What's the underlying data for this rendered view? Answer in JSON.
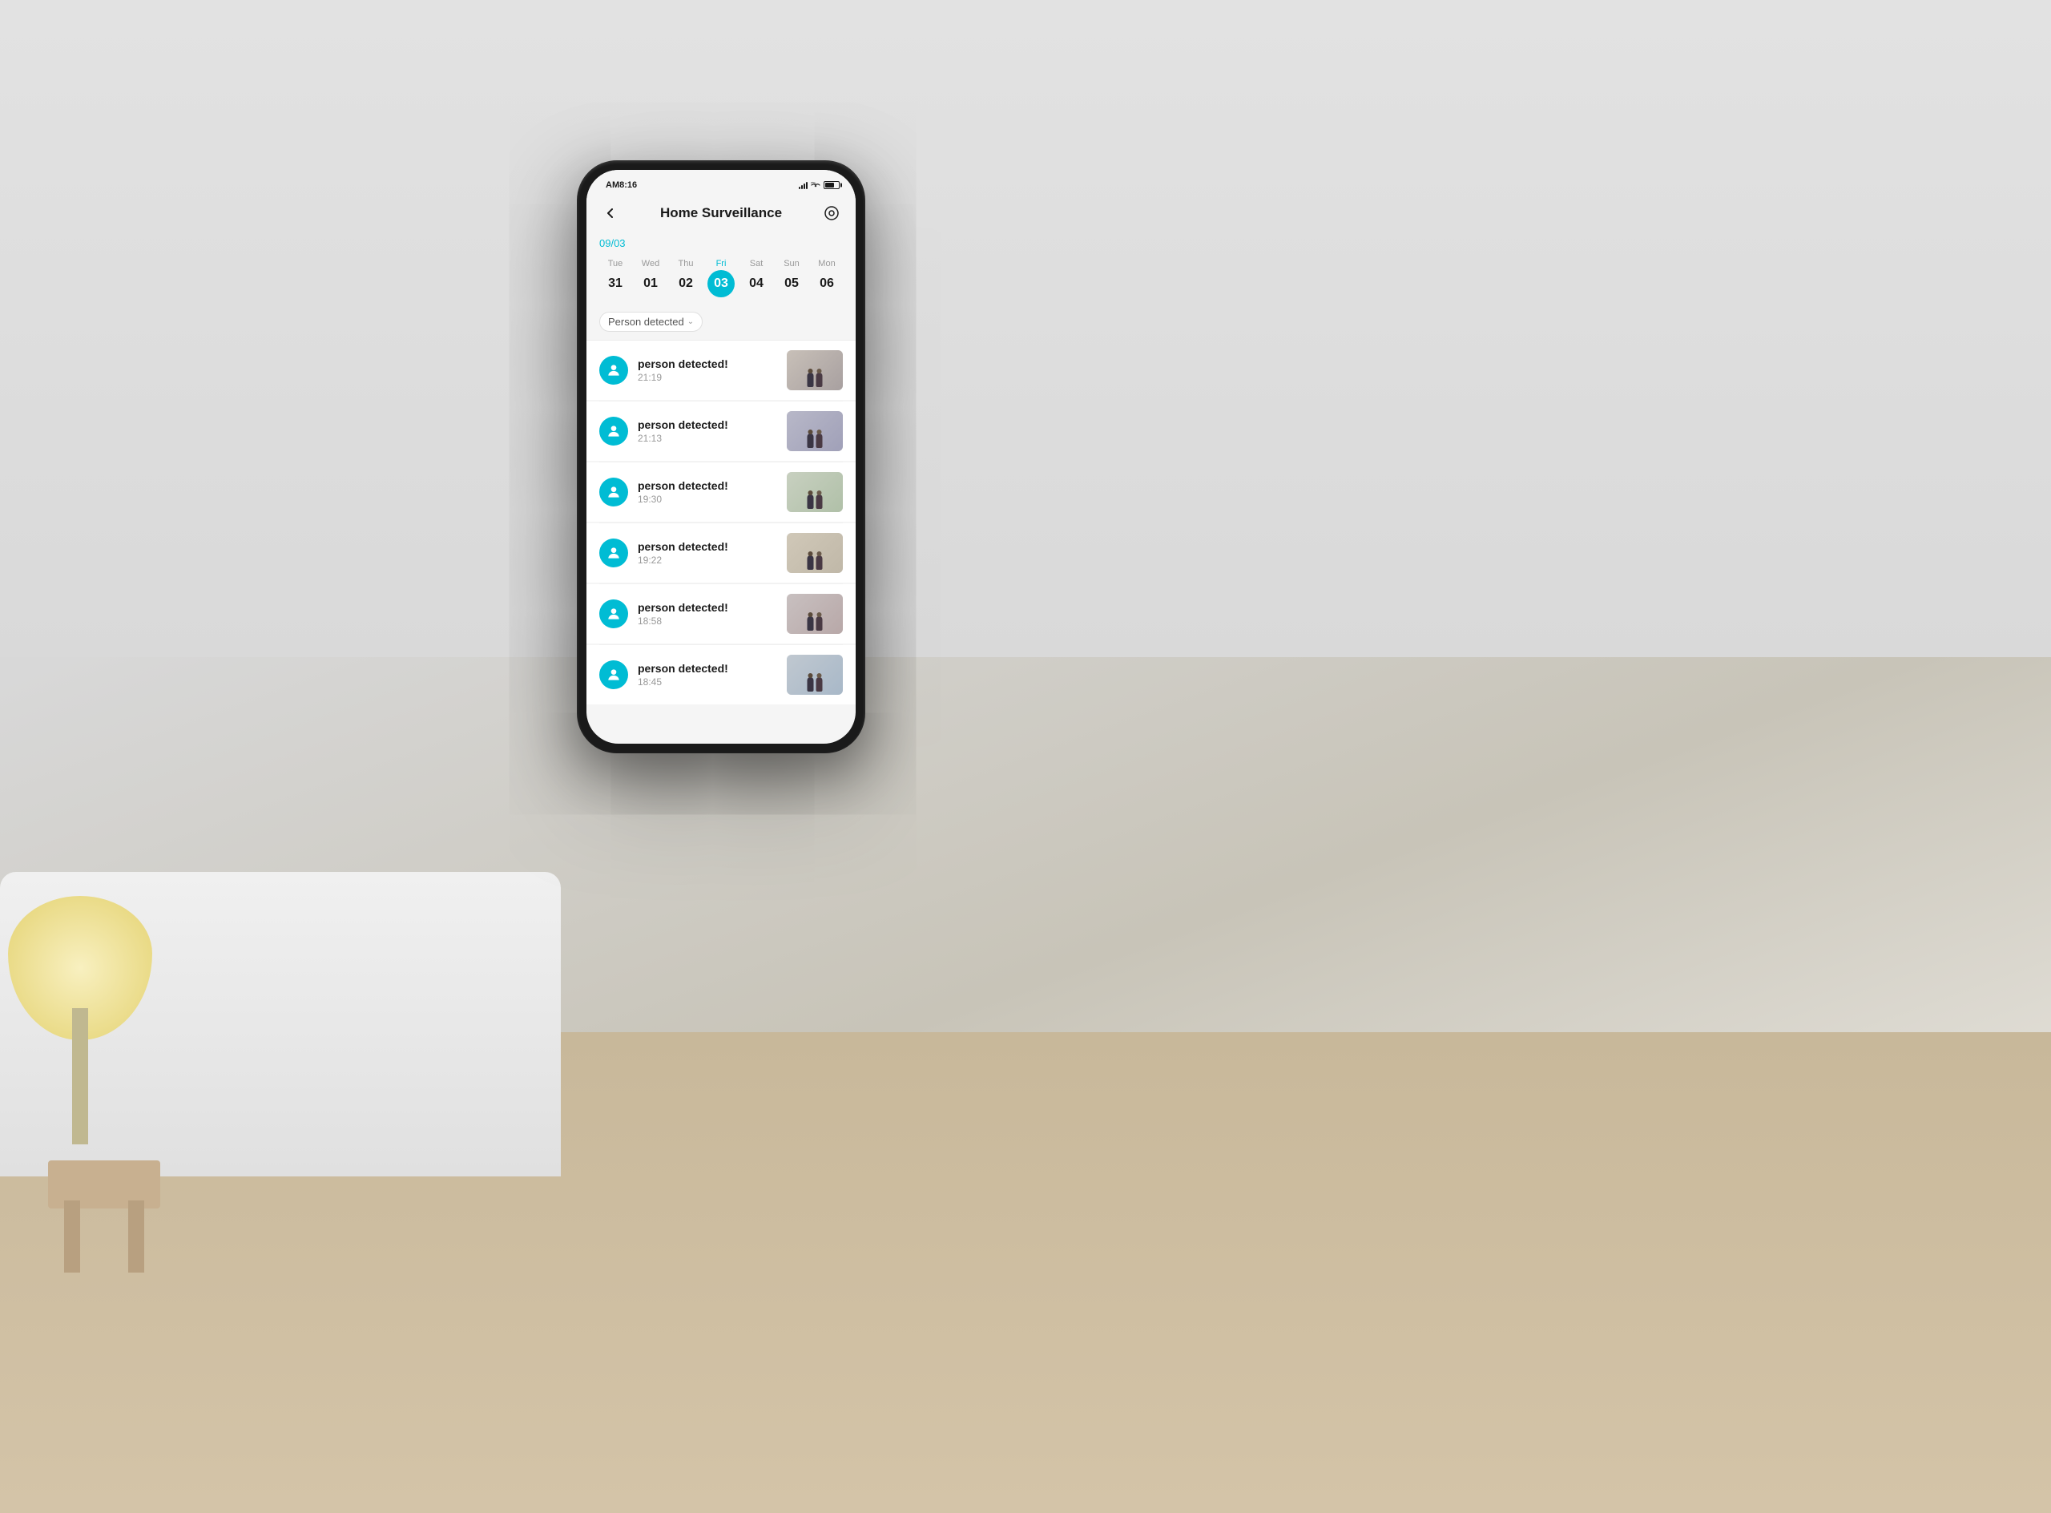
{
  "background": {
    "description": "Blurred living room with white sofa, yellow lamp, light wooden floor"
  },
  "phone": {
    "status_bar": {
      "time": "AM8:16",
      "signal": "signal",
      "wifi": "wifi",
      "battery": "battery"
    },
    "header": {
      "back_label": "←",
      "title": "Home  Surveillance",
      "settings_label": "⊙"
    },
    "current_date": "09/03",
    "calendar": {
      "days": [
        {
          "day": "Tue",
          "num": "31",
          "active": false
        },
        {
          "day": "Wed",
          "num": "01",
          "active": false
        },
        {
          "day": "Thu",
          "num": "02",
          "active": false
        },
        {
          "day": "Fri",
          "num": "03",
          "active": true
        },
        {
          "day": "Sat",
          "num": "04",
          "active": false
        },
        {
          "day": "Sun",
          "num": "05",
          "active": false
        },
        {
          "day": "Mon",
          "num": "06",
          "active": false
        }
      ]
    },
    "filter": {
      "label": "Person detected",
      "arrow": "⌄"
    },
    "events": [
      {
        "title": "person detected!",
        "time": "21:19"
      },
      {
        "title": "person detected!",
        "time": "21:13"
      },
      {
        "title": "person detected!",
        "time": "19:30"
      },
      {
        "title": "person detected!",
        "time": "19:22"
      },
      {
        "title": "person detected!",
        "time": "18:58"
      },
      {
        "title": "person detected!",
        "time": "18:45"
      }
    ]
  }
}
